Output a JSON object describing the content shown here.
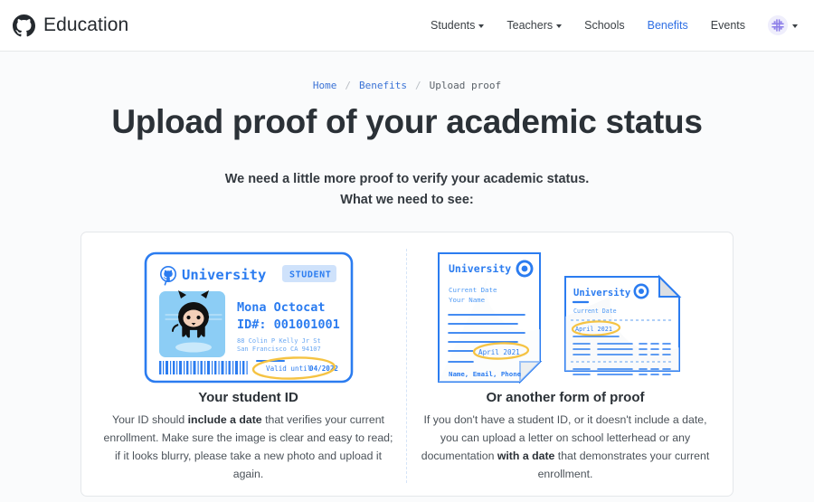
{
  "header": {
    "logo_icon": "github-mark-icon",
    "brand": "Education",
    "nav": [
      {
        "label": "Students",
        "has_caret": true,
        "active": false
      },
      {
        "label": "Teachers",
        "has_caret": true,
        "active": false
      },
      {
        "label": "Schools",
        "has_caret": false,
        "active": false
      },
      {
        "label": "Benefits",
        "has_caret": false,
        "active": true
      },
      {
        "label": "Events",
        "has_caret": false,
        "active": false
      }
    ],
    "avatar_icon": "user-avatar-identicon",
    "avatar_caret": true
  },
  "breadcrumb": {
    "items": [
      "Home",
      "Benefits",
      "Upload proof"
    ],
    "separator": "/"
  },
  "page_title": "Upload proof of your academic status",
  "lede": {
    "line1": "We need a little more proof to verify your academic status.",
    "line2": "What we need to see:"
  },
  "student_id_card": {
    "logo_icon": "github-mark-icon",
    "university": "University",
    "badge": "STUDENT",
    "photo_icon": "octocat-avatar",
    "name": "Mona Octocat",
    "id_line": "ID#: 001001001",
    "address_line1": "88 Colin P Kelly Jr St",
    "address_line2": "San Francisco CA 94107",
    "valid_label": "Valid until",
    "valid_date": "04/2022",
    "barcode_icon": "barcode-icon"
  },
  "letter_doc": {
    "university": "University",
    "logo_icon": "github-mark-icon",
    "current_date": "Current Date",
    "your_name": "Your Name",
    "highlight_date": "April 2021",
    "footer": "Name, Email, Phone"
  },
  "transcript_doc": {
    "university": "University",
    "logo_icon": "github-mark-icon",
    "current_date": "Current Date",
    "highlight_date": "April 2021"
  },
  "columns": [
    {
      "title": "Your student ID",
      "body_pre": "Your ID should ",
      "body_bold": "include a date",
      "body_post": " that verifies your current enrollment. Make sure the image is clear and easy to read; if it looks blurry, please take a new photo and upload it again."
    },
    {
      "title": "Or another form of proof",
      "body_pre": "If you don't have a student ID, or it doesn't include a date, you can upload a letter on school letterhead or any documentation ",
      "body_bold": "with a date",
      "body_post": " that demonstrates your current enrollment."
    }
  ],
  "colors": {
    "accent_blue": "#2f6fe4",
    "link_blue": "#3b73d6",
    "art_blue": "#2b7cf0",
    "highlight_yellow": "#f5c343",
    "avatar_purple": "#8b7ce8",
    "page_bg": "#fafbfc",
    "panel_bg": "#ffffff"
  }
}
